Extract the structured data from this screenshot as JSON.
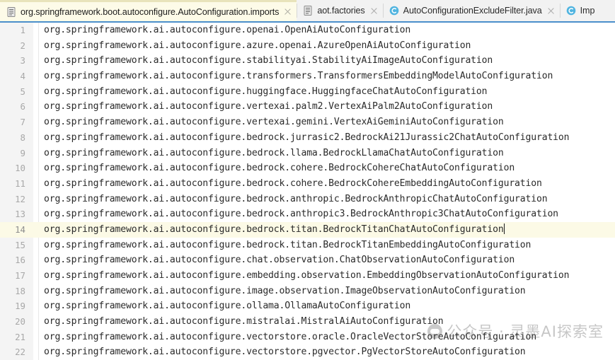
{
  "window": {
    "app": "IntelliJ IDEA Editor",
    "active_file": "org.springframework.boot.autoconfigure.AutoConfiguration.imports"
  },
  "tabbar": {
    "tabs": [
      {
        "label": "org.springframework.boot.autoconfigure.AutoConfiguration.imports",
        "icon": "file-text-icon",
        "active": true,
        "closable": true
      },
      {
        "label": "aot.factories",
        "icon": "file-text-icon",
        "active": false,
        "closable": true
      },
      {
        "label": "AutoConfigurationExcludeFilter.java",
        "icon": "java-class-icon",
        "active": false,
        "closable": true
      },
      {
        "label": "Imp",
        "icon": "java-class-icon",
        "active": false,
        "closable": false
      }
    ],
    "close_glyph": "×"
  },
  "editor": {
    "language": "imports",
    "cursor_line": 14,
    "colors": {
      "current_line_highlight": "#fcfae6",
      "gutter_bg": "#f4f4f4",
      "text": "#2a2a2a",
      "line_number": "#a8a8a8",
      "top_accent": "#4b8fcb",
      "active_tab_bg": "#fdfbe8"
    },
    "lines": [
      {
        "number": "1",
        "text": "org.springframework.ai.autoconfigure.openai.OpenAiAutoConfiguration"
      },
      {
        "number": "2",
        "text": "org.springframework.ai.autoconfigure.azure.openai.AzureOpenAiAutoConfiguration"
      },
      {
        "number": "3",
        "text": "org.springframework.ai.autoconfigure.stabilityai.StabilityAiImageAutoConfiguration"
      },
      {
        "number": "4",
        "text": "org.springframework.ai.autoconfigure.transformers.TransformersEmbeddingModelAutoConfiguration"
      },
      {
        "number": "5",
        "text": "org.springframework.ai.autoconfigure.huggingface.HuggingfaceChatAutoConfiguration"
      },
      {
        "number": "6",
        "text": "org.springframework.ai.autoconfigure.vertexai.palm2.VertexAiPalm2AutoConfiguration"
      },
      {
        "number": "7",
        "text": "org.springframework.ai.autoconfigure.vertexai.gemini.VertexAiGeminiAutoConfiguration"
      },
      {
        "number": "8",
        "text": "org.springframework.ai.autoconfigure.bedrock.jurrasic2.BedrockAi21Jurassic2ChatAutoConfiguration"
      },
      {
        "number": "9",
        "text": "org.springframework.ai.autoconfigure.bedrock.llama.BedrockLlamaChatAutoConfiguration"
      },
      {
        "number": "10",
        "text": "org.springframework.ai.autoconfigure.bedrock.cohere.BedrockCohereChatAutoConfiguration"
      },
      {
        "number": "11",
        "text": "org.springframework.ai.autoconfigure.bedrock.cohere.BedrockCohereEmbeddingAutoConfiguration"
      },
      {
        "number": "12",
        "text": "org.springframework.ai.autoconfigure.bedrock.anthropic.BedrockAnthropicChatAutoConfiguration"
      },
      {
        "number": "13",
        "text": "org.springframework.ai.autoconfigure.bedrock.anthropic3.BedrockAnthropic3ChatAutoConfiguration"
      },
      {
        "number": "14",
        "text": "org.springframework.ai.autoconfigure.bedrock.titan.BedrockTitanChatAutoConfiguration"
      },
      {
        "number": "15",
        "text": "org.springframework.ai.autoconfigure.bedrock.titan.BedrockTitanEmbeddingAutoConfiguration"
      },
      {
        "number": "16",
        "text": "org.springframework.ai.autoconfigure.chat.observation.ChatObservationAutoConfiguration"
      },
      {
        "number": "17",
        "text": "org.springframework.ai.autoconfigure.embedding.observation.EmbeddingObservationAutoConfiguration"
      },
      {
        "number": "18",
        "text": "org.springframework.ai.autoconfigure.image.observation.ImageObservationAutoConfiguration"
      },
      {
        "number": "19",
        "text": "org.springframework.ai.autoconfigure.ollama.OllamaAutoConfiguration"
      },
      {
        "number": "20",
        "text": "org.springframework.ai.autoconfigure.mistralai.MistralAiAutoConfiguration"
      },
      {
        "number": "21",
        "text": "org.springframework.ai.autoconfigure.vectorstore.oracle.OracleVectorStoreAutoConfiguration"
      },
      {
        "number": "22",
        "text": "org.springframework.ai.autoconfigure.vectorstore.pgvector.PgVectorStoreAutoConfiguration"
      }
    ]
  },
  "watermark": {
    "text": "公众号 · 灵墨AI探索室"
  }
}
